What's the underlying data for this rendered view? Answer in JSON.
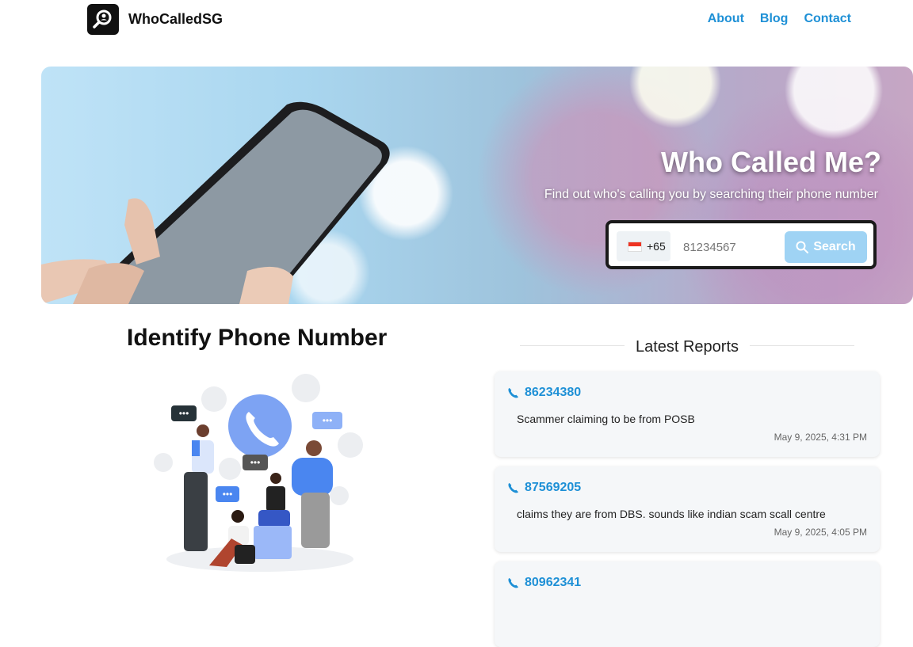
{
  "header": {
    "brand": "WhoCalledSG",
    "nav": [
      "About",
      "Blog",
      "Contact"
    ]
  },
  "hero": {
    "title": "Who Called Me?",
    "subtitle": "Find out who's calling you by searching their phone number",
    "search": {
      "country_code": "+65",
      "placeholder": "81234567",
      "button_label": "Search"
    }
  },
  "identify": {
    "title": "Identify Phone Number"
  },
  "reports": {
    "title": "Latest Reports",
    "items": [
      {
        "number": "86234380",
        "description": "Scammer claiming to be from POSB",
        "time": "May 9, 2025, 4:31 PM"
      },
      {
        "number": "87569205",
        "description": "claims they are from DBS. sounds like indian scam scall centre",
        "time": "May 9, 2025, 4:05 PM"
      },
      {
        "number": "80962341",
        "description": "",
        "time": ""
      }
    ]
  },
  "colors": {
    "accent": "#1e90d6",
    "search_button": "#9fd3f4",
    "card_bg": "#f5f7f9"
  }
}
